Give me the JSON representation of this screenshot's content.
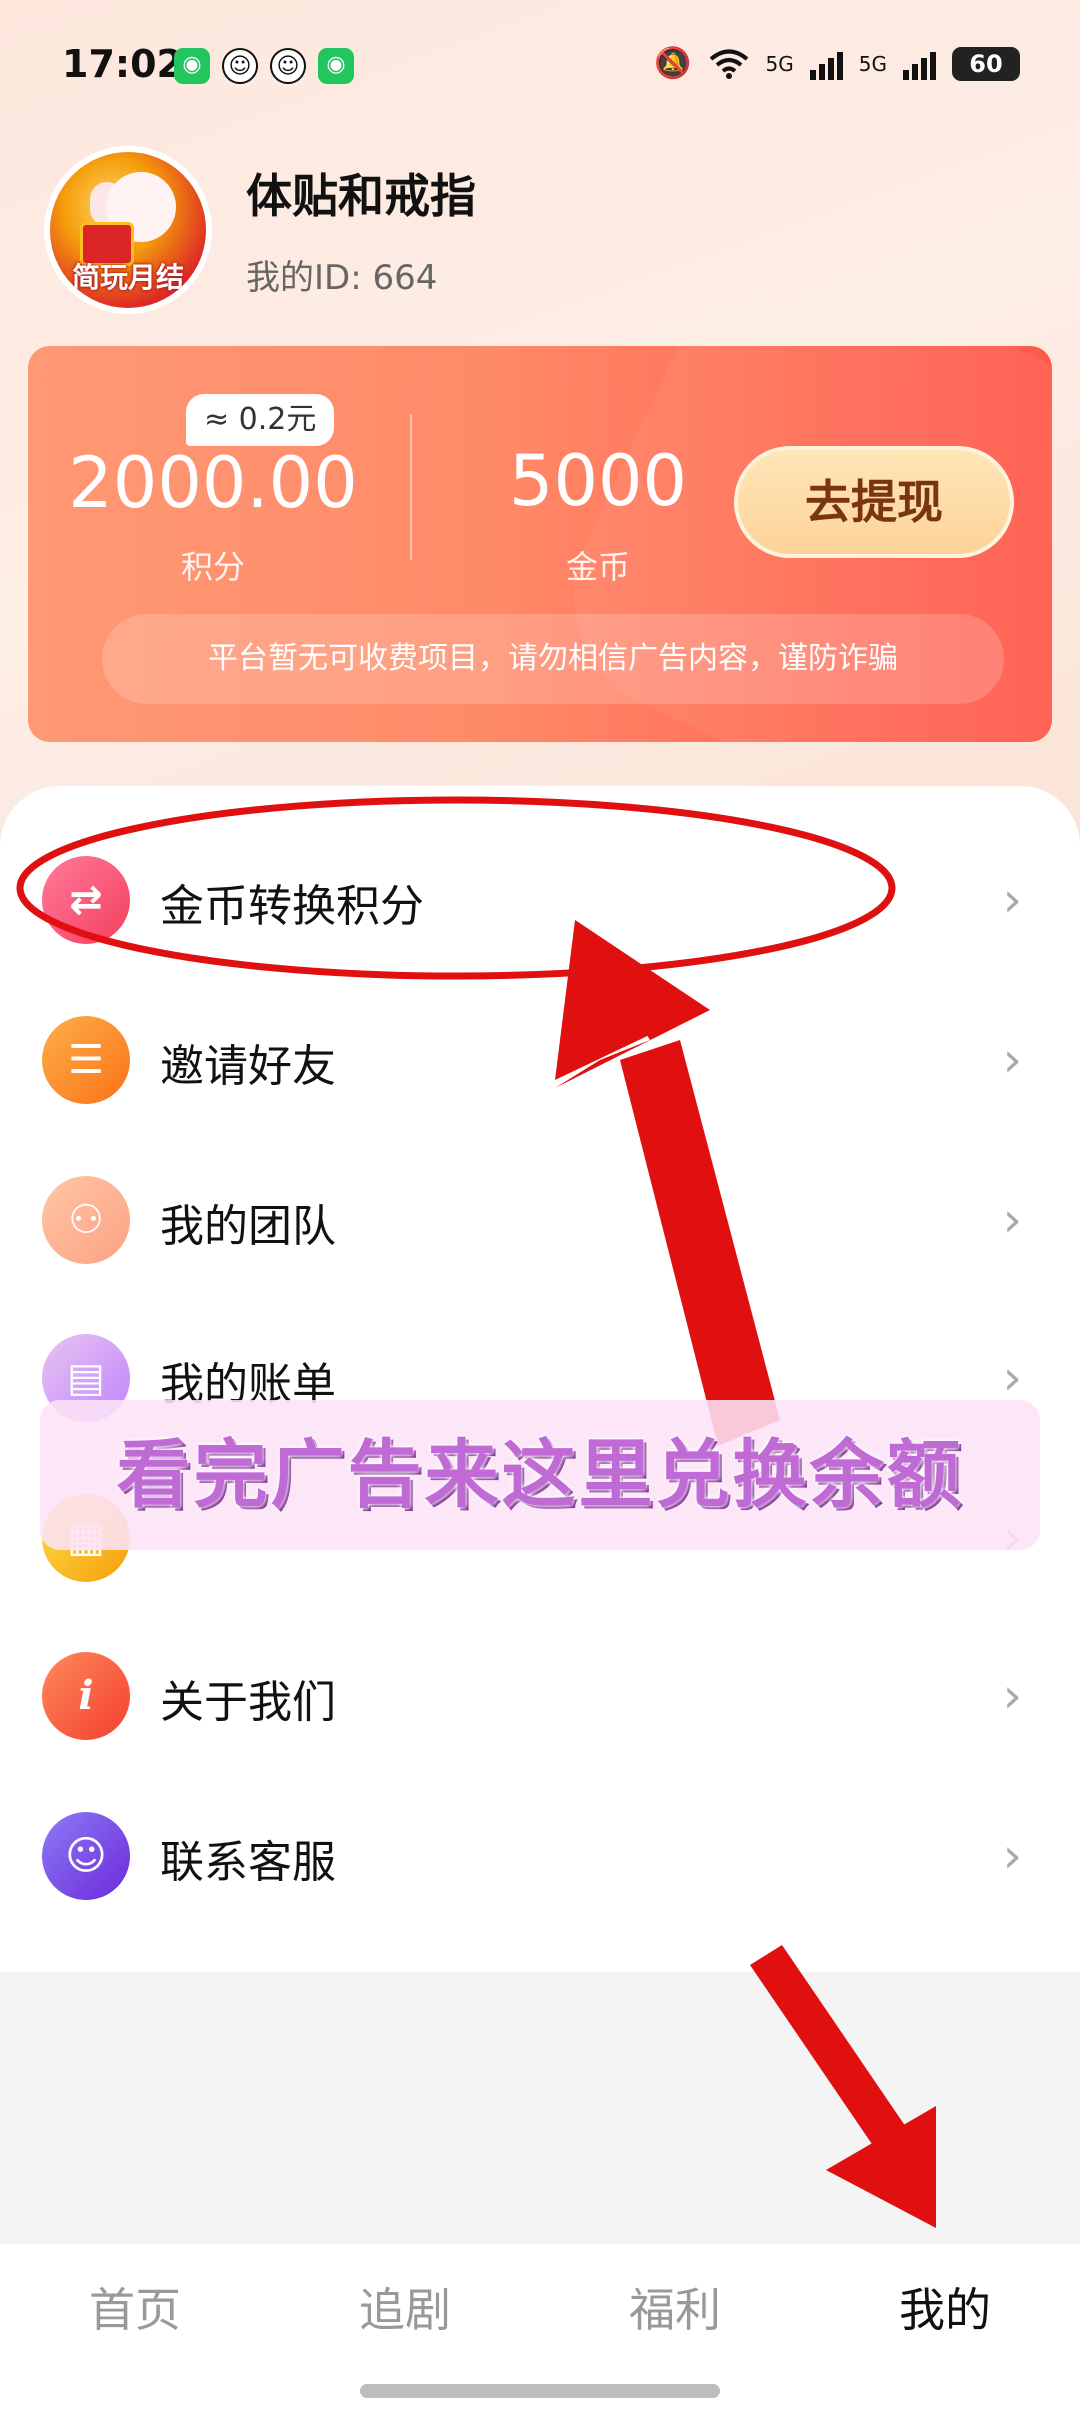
{
  "status_bar": {
    "time": "17:02",
    "notification_apps": [
      "wechat-icon",
      "qq-icon",
      "qq-icon",
      "wechat-icon"
    ],
    "network": "5G",
    "battery": "60"
  },
  "profile": {
    "avatar_text": "简玩月结",
    "username": "体贴和戒指",
    "user_id": "我的ID: 664"
  },
  "points_card": {
    "approx_badge": "≈ 0.2元",
    "points_value": "2000.00",
    "points_label": "积分",
    "coins_value": "5000",
    "coins_label": "金币",
    "withdraw_label": "去提现",
    "notice": "平台暂无可收费项目，请勿相信广告内容，谨防诈骗"
  },
  "menu": {
    "items": [
      {
        "label": "金币转换积分",
        "icon": "exchange-arrows-icon"
      },
      {
        "label": "邀请好友",
        "icon": "invite-card-icon"
      },
      {
        "label": "我的团队",
        "icon": "team-icon"
      },
      {
        "label": "我的账单",
        "icon": "bill-icon"
      },
      {
        "label": "",
        "icon": "course-icon"
      },
      {
        "label": "关于我们",
        "icon": "info-icon"
      },
      {
        "label": "联系客服",
        "icon": "customer-service-icon"
      }
    ],
    "chevron": "›"
  },
  "overlay": {
    "banner_text": "看完广告来这里兑换余额",
    "annotation_color": "#e01010"
  },
  "bottom_nav": {
    "items": [
      {
        "label": "首页",
        "active": false
      },
      {
        "label": "追剧",
        "active": false
      },
      {
        "label": "福利",
        "active": false
      },
      {
        "label": "我的",
        "active": true
      }
    ]
  },
  "colors": {
    "card_start": "#ff9874",
    "card_end": "#ff5a4c",
    "withdraw_button": "#fdd39a",
    "active_nav": "#111111",
    "inactive_nav": "#999999"
  }
}
